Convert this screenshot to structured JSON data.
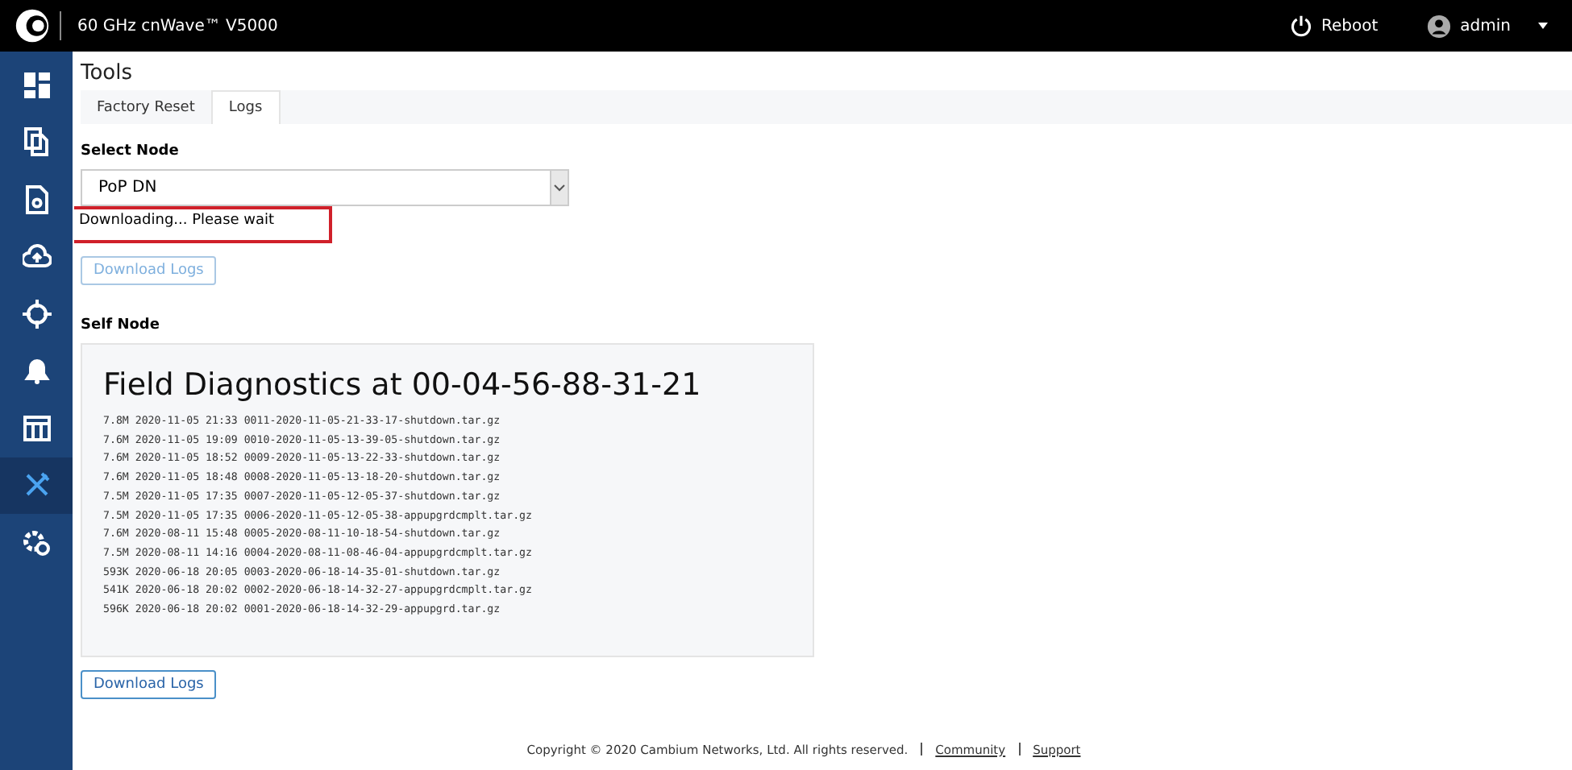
{
  "header": {
    "title": "60 GHz cnWave™ V5000",
    "reboot": "Reboot",
    "user": "admin"
  },
  "sidebar": {
    "items": [
      {
        "selected": false
      },
      {
        "selected": false
      },
      {
        "selected": false
      },
      {
        "selected": false
      },
      {
        "selected": false
      },
      {
        "selected": false
      },
      {
        "selected": false
      },
      {
        "selected": true
      },
      {
        "selected": false
      }
    ]
  },
  "page_title": "Tools",
  "tabs": [
    {
      "label": "Factory Reset",
      "selected": false
    },
    {
      "label": "Logs",
      "selected": true
    }
  ],
  "select_label": "Select Node",
  "select_value": "PoP DN",
  "status_message": "Downloading... Please wait",
  "download_button_top": {
    "label": "Download Logs",
    "disabled": true
  },
  "self_node_label": "Self Node",
  "diagnostics": {
    "title": "Field Diagnostics at 00-04-56-88-31-21",
    "lines": [
      "7.8M 2020-11-05 21:33 0011-2020-11-05-21-33-17-shutdown.tar.gz",
      "7.6M 2020-11-05 19:09 0010-2020-11-05-13-39-05-shutdown.tar.gz",
      "7.6M 2020-11-05 18:52 0009-2020-11-05-13-22-33-shutdown.tar.gz",
      "7.6M 2020-11-05 18:48 0008-2020-11-05-13-18-20-shutdown.tar.gz",
      "7.5M 2020-11-05 17:35 0007-2020-11-05-12-05-37-shutdown.tar.gz",
      "7.5M 2020-11-05 17:35 0006-2020-11-05-12-05-38-appupgrdcmplt.tar.gz",
      "7.6M 2020-08-11 15:48 0005-2020-08-11-10-18-54-shutdown.tar.gz",
      "7.5M 2020-08-11 14:16 0004-2020-08-11-08-46-04-appupgrdcmplt.tar.gz",
      "593K 2020-06-18 20:05 0003-2020-06-18-14-35-01-shutdown.tar.gz",
      "541K 2020-06-18 20:02 0002-2020-06-18-14-32-27-appupgrdcmplt.tar.gz",
      "596K 2020-06-18 20:02 0001-2020-06-18-14-32-29-appupgrd.tar.gz"
    ]
  },
  "download_button_bottom": {
    "label": "Download Logs",
    "disabled": false
  },
  "footer": {
    "copyright": "Copyright © 2020 Cambium Networks, Ltd. All rights reserved.",
    "links": [
      "Community",
      "Support"
    ]
  }
}
